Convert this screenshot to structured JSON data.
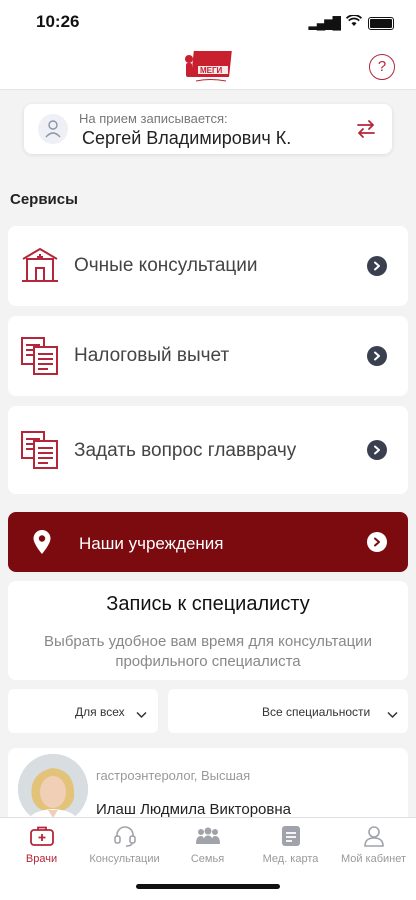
{
  "status": {
    "time": "10:26"
  },
  "header": {
    "help_label": "?"
  },
  "patient": {
    "caption": "На прием записывается:",
    "name": "Сергей Владимирович К."
  },
  "services": {
    "title": "Сервисы",
    "items": [
      {
        "label": "Очные консультации",
        "icon": "hospital-icon"
      },
      {
        "label": "Налоговый вычет",
        "icon": "documents-icon"
      },
      {
        "label": "Задать вопрос главврачу",
        "icon": "documents-icon"
      }
    ],
    "institutions": {
      "label": "Наши учреждения",
      "icon": "location-pin-icon"
    }
  },
  "booking": {
    "title": "Запись к специалисту",
    "description": "Выбрать удобное вам время для консультации профильного специалиста",
    "filter_audience": "Для всех",
    "filter_specialty": "Все специальности"
  },
  "doctor": {
    "specialty": "гастроэнтеролог, Высшая",
    "name": "Илаш Людмила Викторовна"
  },
  "tabs": [
    {
      "label": "Врачи",
      "icon": "doctor-case-icon",
      "active": true
    },
    {
      "label": "Консультации",
      "icon": "headset-icon",
      "active": false
    },
    {
      "label": "Семья",
      "icon": "family-icon",
      "active": false
    },
    {
      "label": "Мед. карта",
      "icon": "med-card-icon",
      "active": false
    },
    {
      "label": "Мой кабинет",
      "icon": "profile-icon",
      "active": false
    }
  ],
  "colors": {
    "brand": "#b5263a",
    "institution_bg": "#7b0b0f",
    "chevron_dark": "#3a4050",
    "page_bg": "#f3f3f4"
  }
}
